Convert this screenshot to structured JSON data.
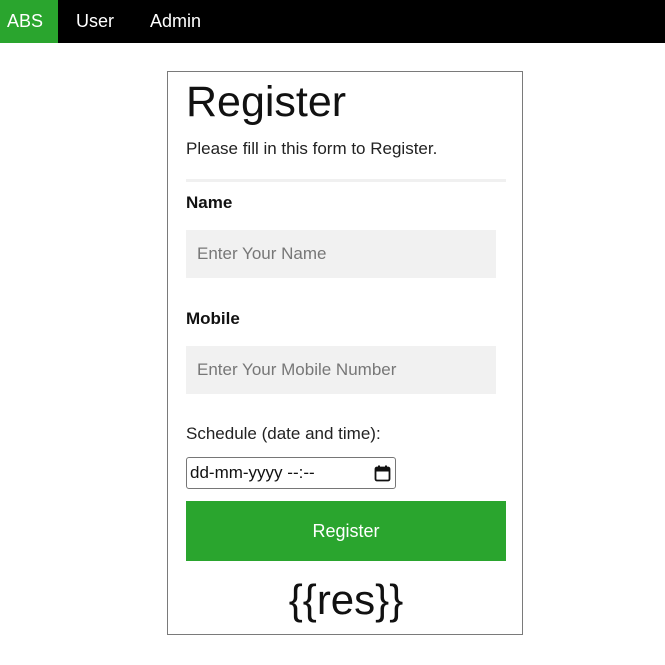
{
  "nav": {
    "items": [
      {
        "label": "ABS",
        "active": true
      },
      {
        "label": "User",
        "active": false
      },
      {
        "label": "Admin",
        "active": false
      }
    ]
  },
  "form": {
    "title": "Register",
    "subtitle": "Please fill in this form to Register.",
    "name_label": "Name",
    "name_placeholder": "Enter Your Name",
    "mobile_label": "Mobile",
    "mobile_placeholder": "Enter Your Mobile Number",
    "schedule_label": "Schedule (date and time):",
    "schedule_value": "dd-mm-yyyy --:--",
    "submit_label": "Register",
    "result_text": "{{res}}"
  },
  "colors": {
    "accent": "#2aa52e",
    "nav_bg": "#000000",
    "input_bg": "#f1f1f1"
  },
  "icons": {
    "calendar": "calendar-icon"
  }
}
